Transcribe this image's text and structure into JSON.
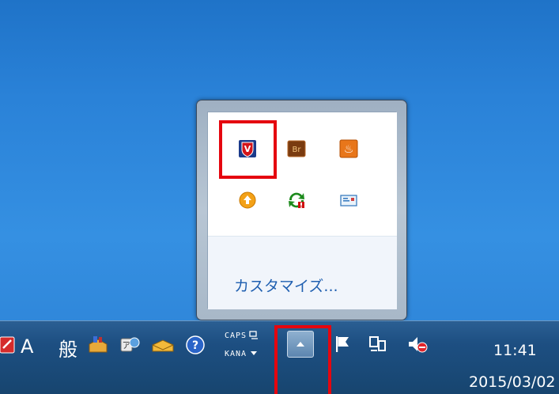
{
  "flyout": {
    "customize_label": "カスタマイズ...",
    "icons": [
      {
        "name": "mcafee-shield-icon",
        "text": "V"
      },
      {
        "name": "adobe-bridge-icon",
        "text": "Br"
      },
      {
        "name": "java-icon",
        "text": "♨"
      },
      {
        "name": "update-arrow-icon",
        "text": "↑"
      },
      {
        "name": "sync-error-icon",
        "text": ""
      },
      {
        "name": "mail-icon",
        "text": ""
      }
    ]
  },
  "taskbar": {
    "ime_mode": "A",
    "ime_kanji": "般",
    "caps_label": "CAPS",
    "kana_label": "KANA",
    "help_symbol": "?",
    "clock_time": "11:41",
    "clock_date": "2015/03/02"
  },
  "colors": {
    "highlight": "#e5060f",
    "link": "#1f5fb0"
  }
}
